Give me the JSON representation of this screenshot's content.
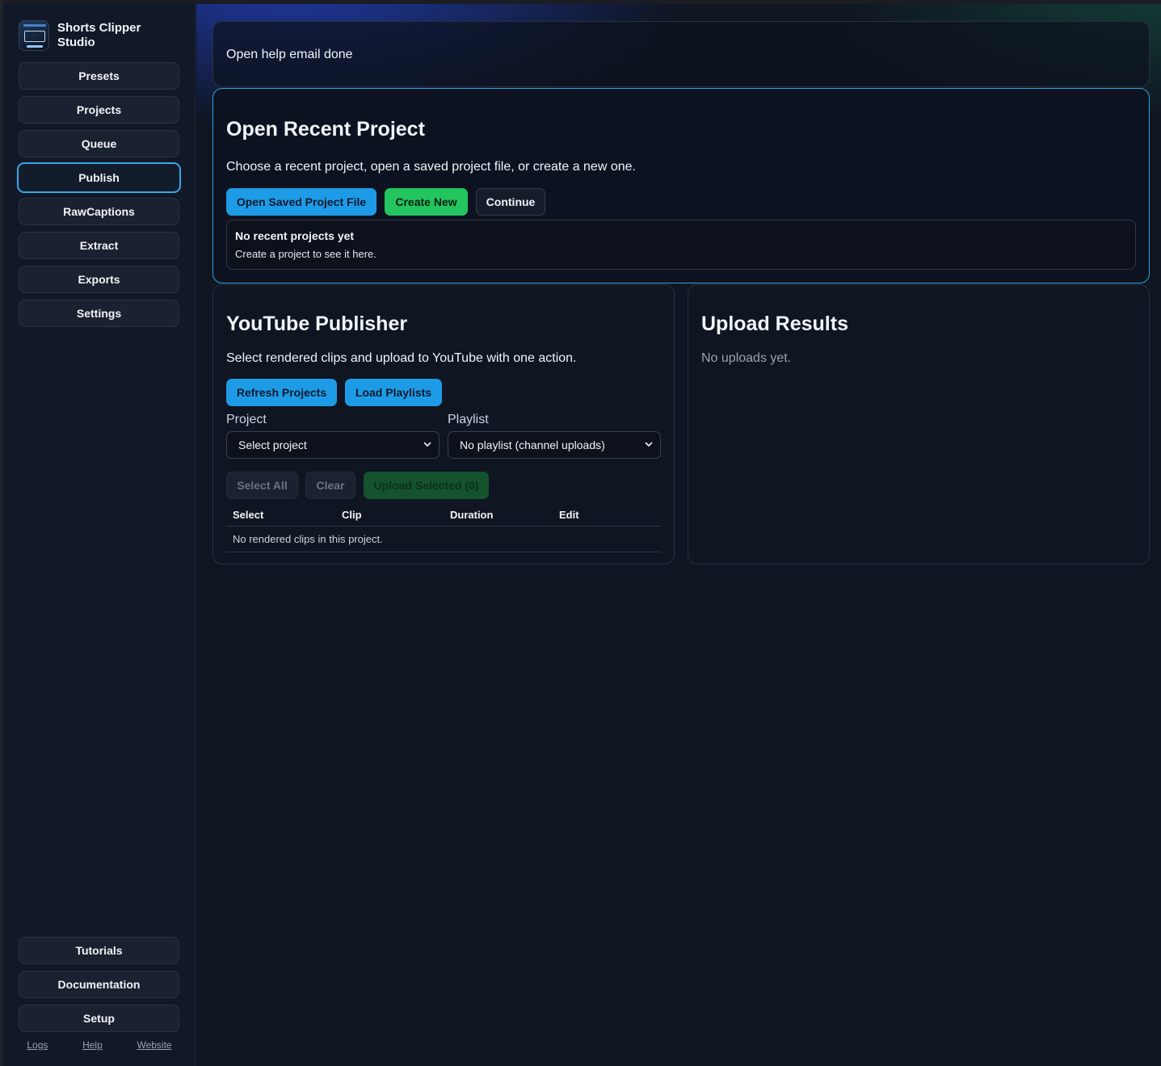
{
  "app": {
    "name": "Shorts Clipper Studio"
  },
  "sidebar": {
    "items": [
      {
        "label": "Presets"
      },
      {
        "label": "Projects"
      },
      {
        "label": "Queue"
      },
      {
        "label": "Publish",
        "active": true
      },
      {
        "label": "RawCaptions"
      },
      {
        "label": "Extract"
      },
      {
        "label": "Exports"
      },
      {
        "label": "Settings"
      }
    ],
    "bottom_items": [
      {
        "label": "Tutorials"
      },
      {
        "label": "Documentation"
      },
      {
        "label": "Setup"
      }
    ],
    "links": [
      {
        "label": "Logs"
      },
      {
        "label": "Help"
      },
      {
        "label": "Website"
      }
    ]
  },
  "status": {
    "message": "Open help email done"
  },
  "recent": {
    "title": "Open Recent Project",
    "description": "Choose a recent project, open a saved project file, or create a new one.",
    "open_saved_label": "Open Saved Project File",
    "create_new_label": "Create New",
    "continue_label": "Continue",
    "empty_title": "No recent projects yet",
    "empty_subtitle": "Create a project to see it here."
  },
  "publisher": {
    "title": "YouTube Publisher",
    "description": "Select rendered clips and upload to YouTube with one action.",
    "refresh_label": "Refresh Projects",
    "load_playlists_label": "Load Playlists",
    "project_label": "Project",
    "project_value": "Select project",
    "playlist_label": "Playlist",
    "playlist_value": "No playlist (channel uploads)",
    "select_all_label": "Select All",
    "clear_label": "Clear",
    "upload_selected_label": "Upload Selected (0)",
    "columns": [
      "Select",
      "Clip",
      "Duration",
      "Edit"
    ],
    "empty_message": "No rendered clips in this project."
  },
  "results": {
    "title": "Upload Results",
    "empty_message": "No uploads yet."
  },
  "colors": {
    "accent_blue": "#1e9be6",
    "accent_green": "#22c55e",
    "active_border": "#38a8e8",
    "background": "#0f1521"
  }
}
